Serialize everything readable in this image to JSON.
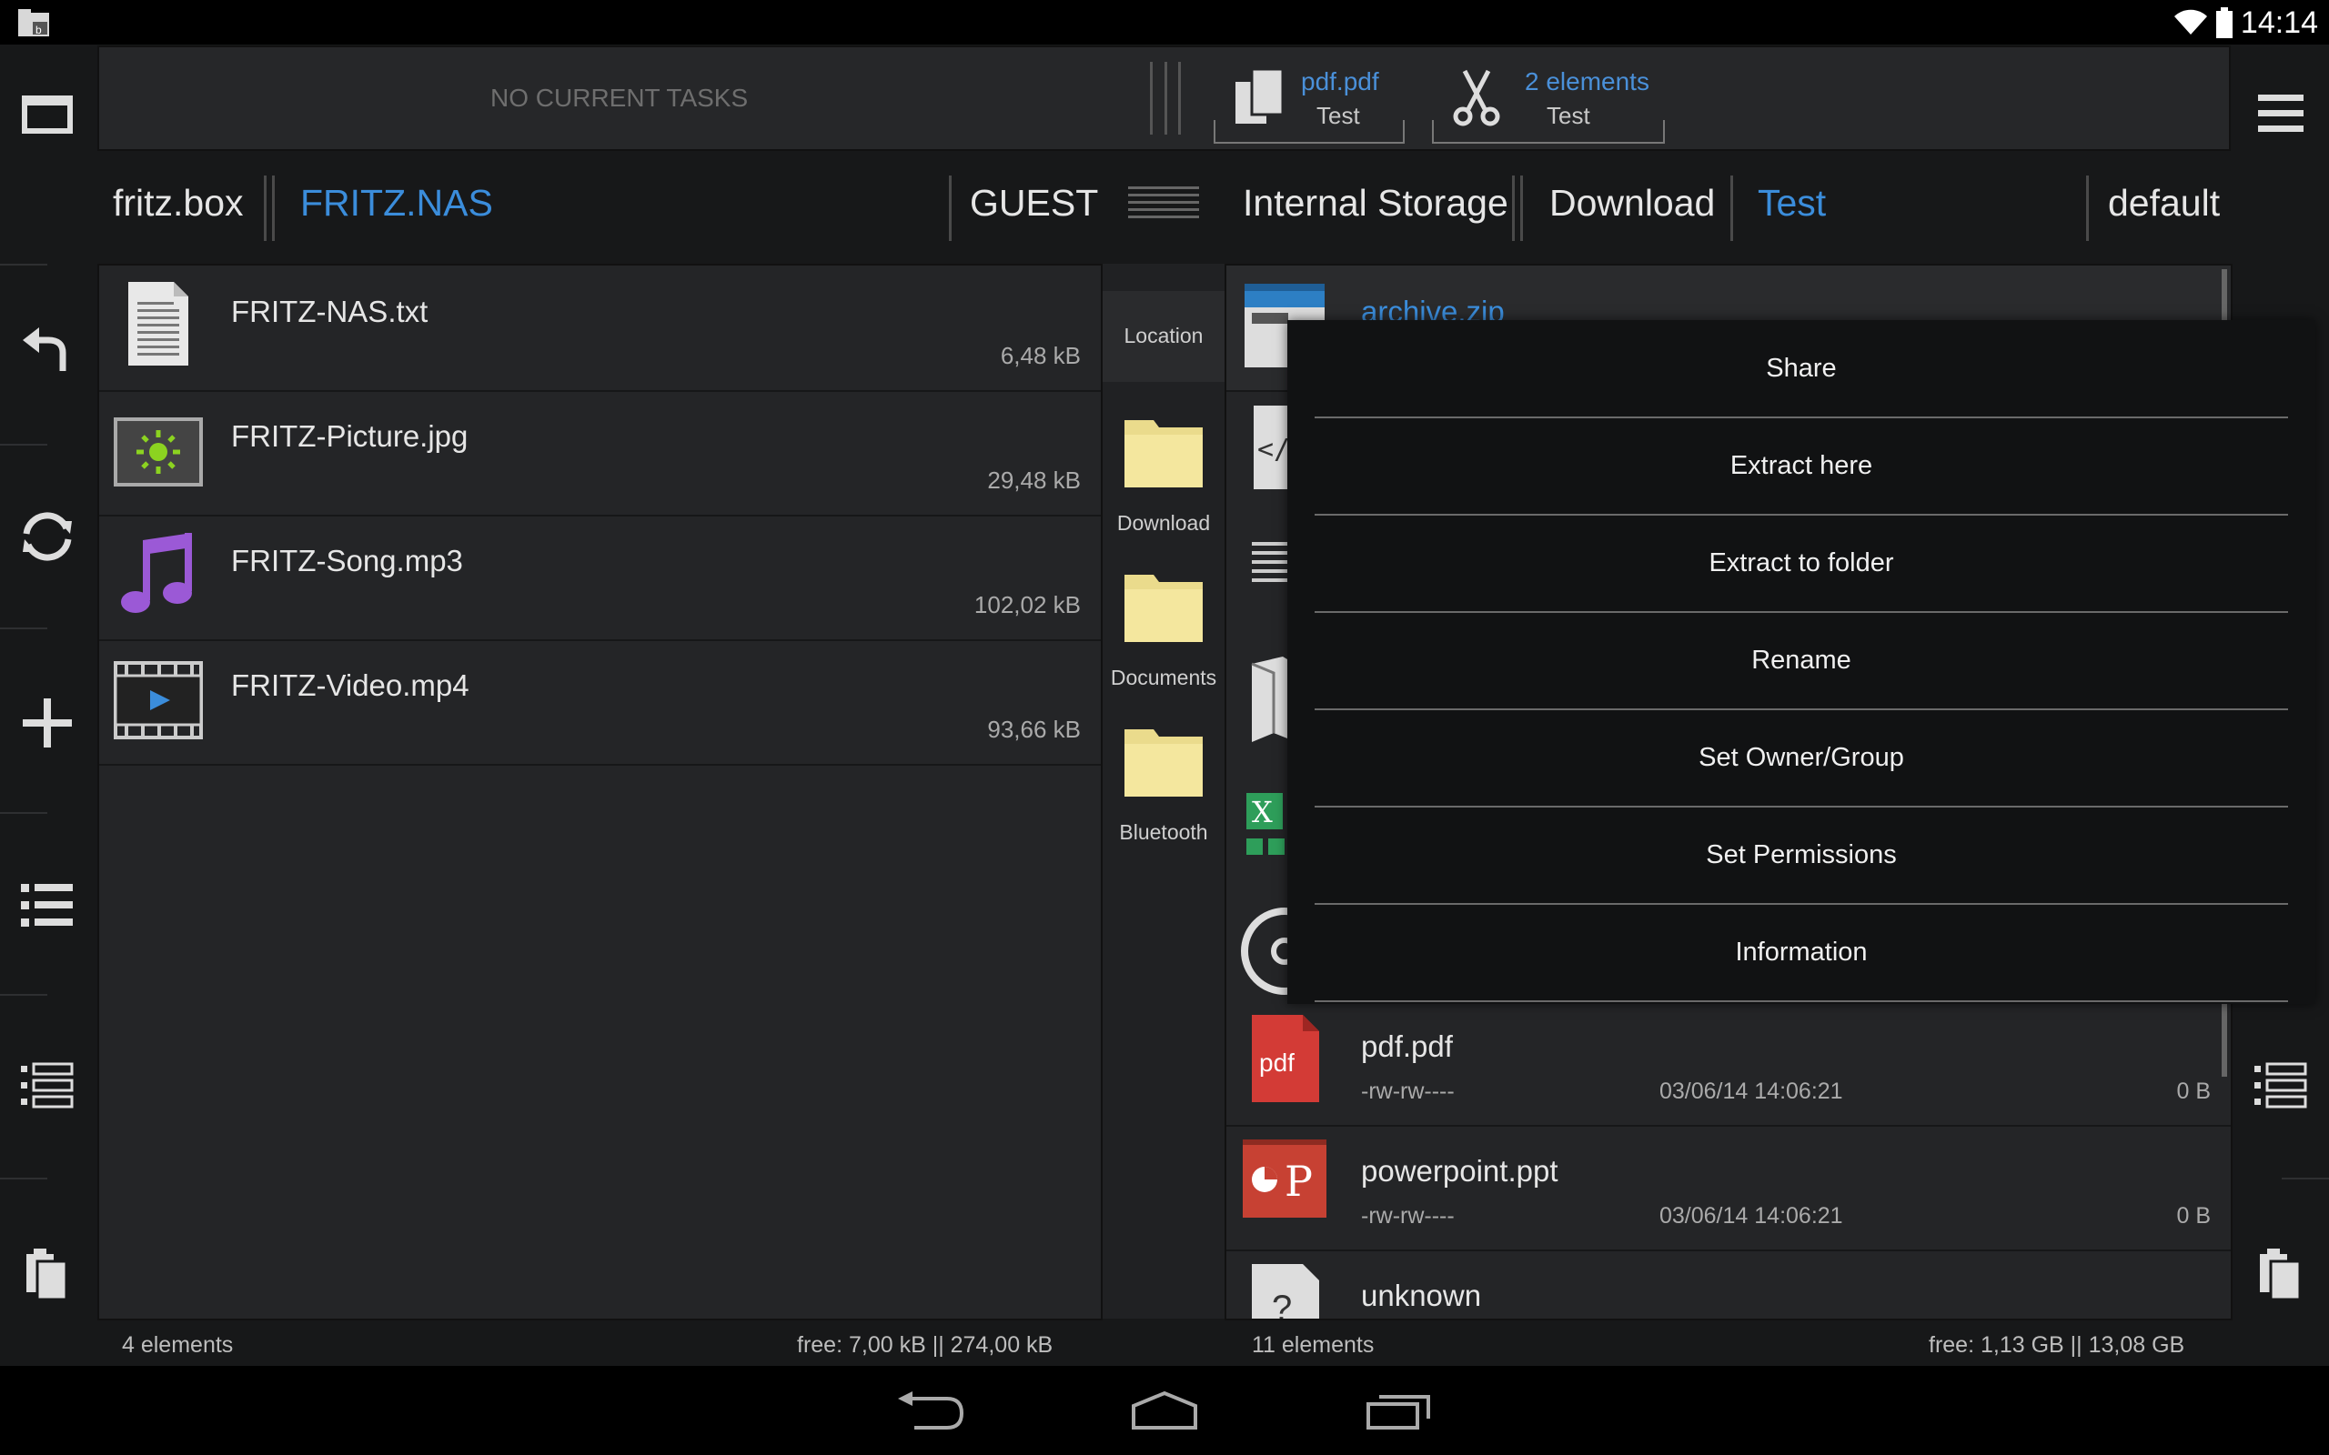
{
  "status_bar": {
    "time": "14:14"
  },
  "taskbar": {
    "no_tasks": "NO CURRENT TASKS",
    "clipboard": [
      {
        "name": "pdf.pdf",
        "location": "Test"
      },
      {
        "name": "2 elements",
        "location": "Test"
      }
    ]
  },
  "left_pane": {
    "breadcrumbs": [
      "fritz.box",
      "FRITZ.NAS"
    ],
    "user": "GUEST",
    "files": [
      {
        "name": "FRITZ-NAS.txt",
        "size": "6,48 kB",
        "icon": "text-file-icon"
      },
      {
        "name": "FRITZ-Picture.jpg",
        "size": "29,48 kB",
        "icon": "image-file-icon"
      },
      {
        "name": "FRITZ-Song.mp3",
        "size": "102,02 kB",
        "icon": "music-note-icon"
      },
      {
        "name": "FRITZ-Video.mp4",
        "size": "93,66 kB",
        "icon": "video-file-icon"
      }
    ],
    "footer_count": "4 elements",
    "footer_free": "free: 7,00 kB || 274,00 kB"
  },
  "middle": {
    "header": "Location",
    "locations": [
      "Download",
      "Documents",
      "Bluetooth"
    ]
  },
  "right_pane": {
    "breadcrumbs": [
      "Internal Storage",
      "Download",
      "Test"
    ],
    "profile": "default",
    "files": [
      {
        "name": "archive.zip",
        "icon": "archive-icon"
      },
      {
        "name": "pdf.pdf",
        "perms": "-rw-rw----",
        "date": "03/06/14 14:06:21",
        "size": "0 B",
        "icon": "pdf-file-icon"
      },
      {
        "name": "powerpoint.ppt",
        "perms": "-rw-rw----",
        "date": "03/06/14 14:06:21",
        "size": "0 B",
        "icon": "powerpoint-file-icon"
      },
      {
        "name": "unknown",
        "icon": "unknown-file-icon"
      }
    ],
    "footer_count": "11 elements",
    "footer_free": "free: 1,13 GB || 13,08 GB"
  },
  "context_menu": {
    "items": [
      "Share",
      "Extract here",
      "Extract to folder",
      "Rename",
      "Set Owner/Group",
      "Set Permissions",
      "Information"
    ]
  },
  "colors": {
    "accent": "#3b8ddb",
    "background": "#171819",
    "pane": "#242527"
  }
}
